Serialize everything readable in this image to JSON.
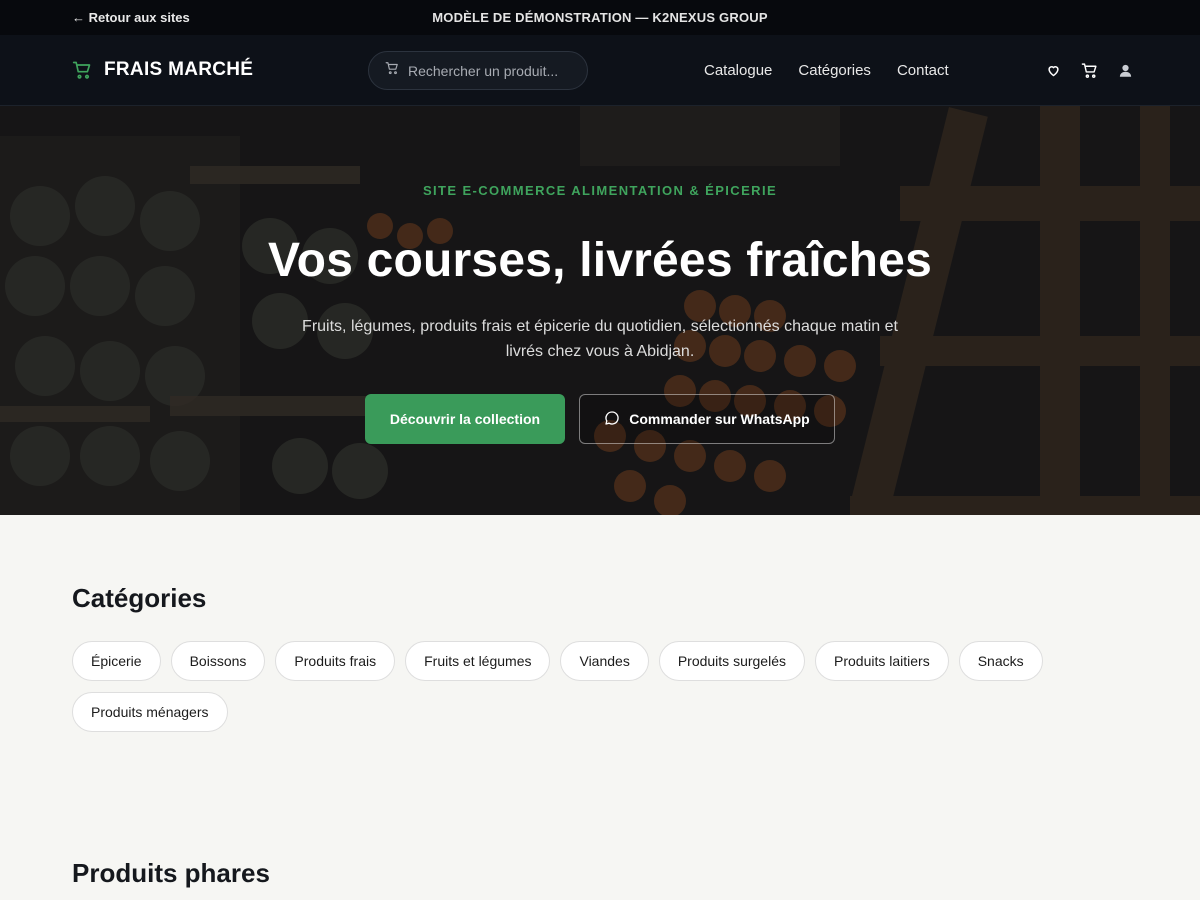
{
  "demo_bar": {
    "back_label": "← Retour aux sites",
    "title": "MODÈLE DE DÉMONSTRATION — K2NEXUS GROUP"
  },
  "header": {
    "brand": "FRAIS MARCHÉ",
    "brand_icon": "shopping-cart-icon",
    "search_placeholder": "Rechercher un produit...",
    "nav": [
      "Catalogue",
      "Catégories",
      "Contact"
    ],
    "icons": [
      "heart-icon",
      "cart-icon",
      "user-icon"
    ]
  },
  "hero": {
    "eyebrow": "SITE E-COMMERCE ALIMENTATION & ÉPICERIE",
    "title": "Vos courses, livrées fraîches",
    "subtitle": "Fruits, légumes, produits frais et épicerie du quotidien, sélectionnés chaque matin et livrés chez vous à Abidjan.",
    "primary_cta": "Découvrir la collection",
    "secondary_cta": "Commander sur WhatsApp"
  },
  "categories": {
    "title": "Catégories",
    "items": [
      "Épicerie",
      "Boissons",
      "Produits frais",
      "Fruits et légumes",
      "Viandes",
      "Produits surgelés",
      "Produits laitiers",
      "Snacks",
      "Produits ménagers"
    ]
  },
  "featured": {
    "title": "Produits phares"
  },
  "colors": {
    "accent": "#3a9b5a",
    "header_bg": "#0d1118",
    "demo_bar_bg": "#07090d",
    "page_bg": "#f6f6f3"
  }
}
